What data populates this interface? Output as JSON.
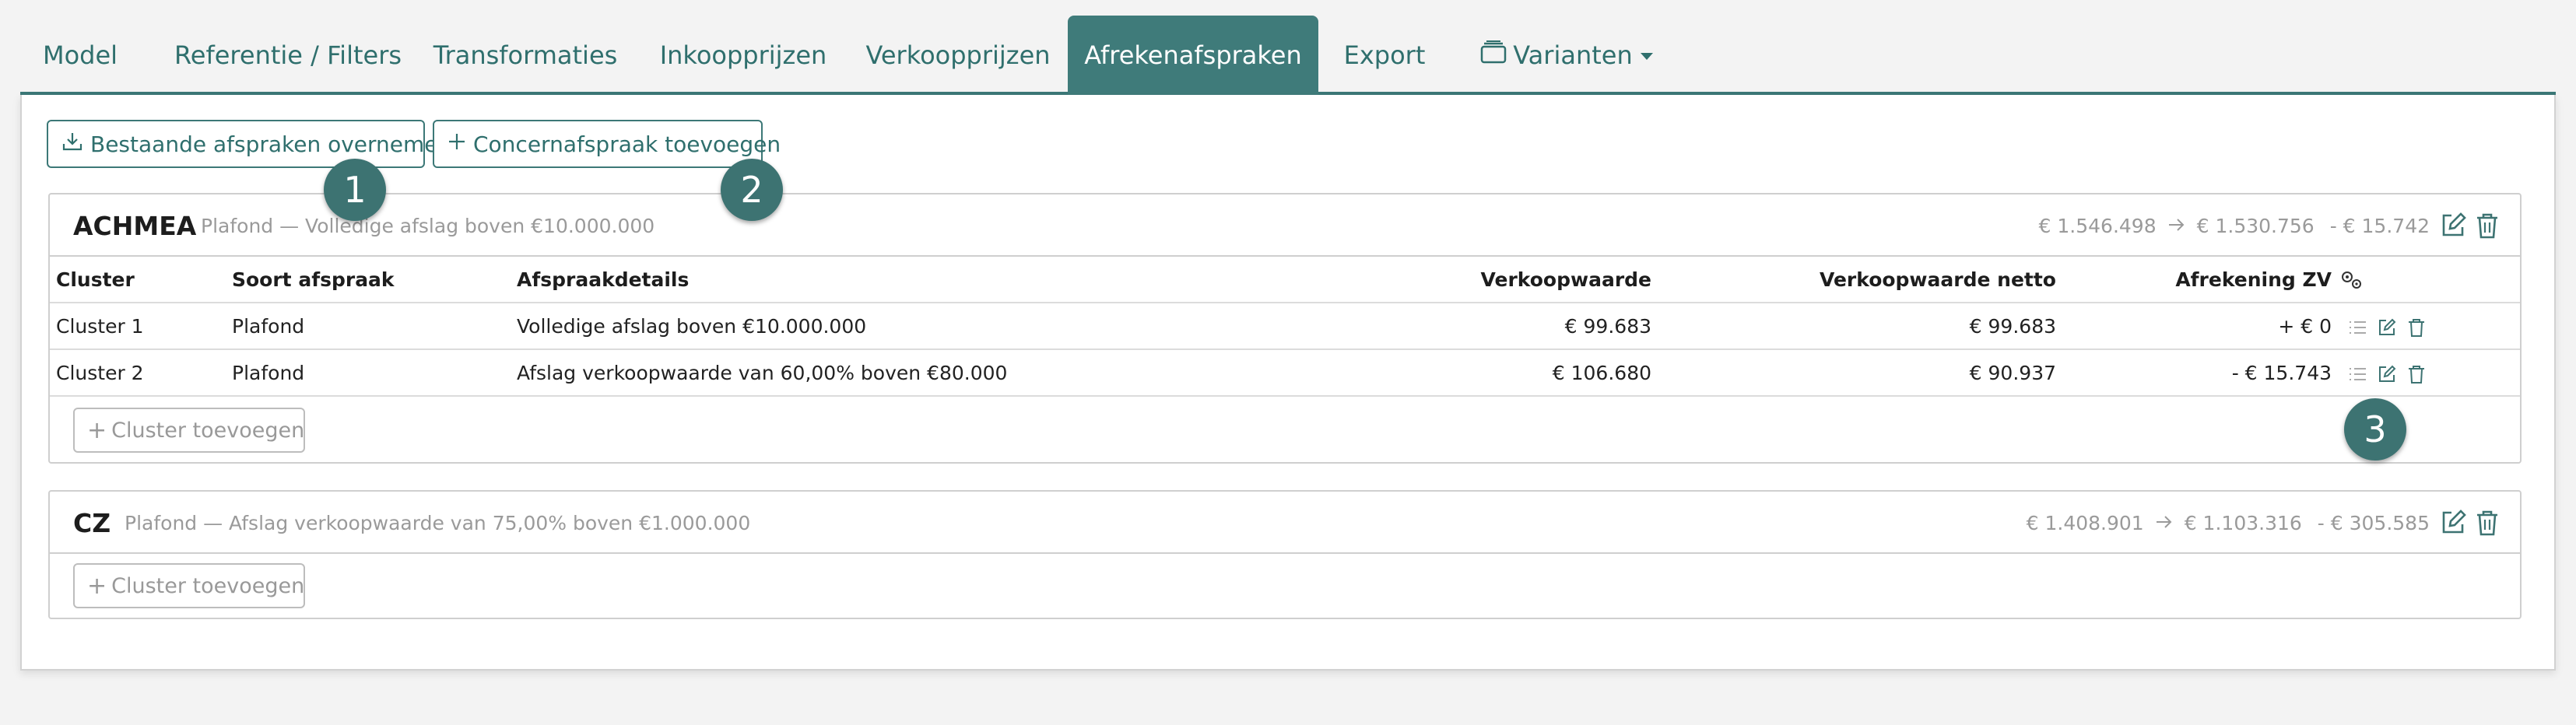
{
  "tabs": [
    {
      "label": "Model"
    },
    {
      "label": "Referentie / Filters"
    },
    {
      "label": "Transformaties"
    },
    {
      "label": "Inkoopprijzen"
    },
    {
      "label": "Verkoopprijzen"
    },
    {
      "label": "Afrekenafspraken",
      "active": true
    },
    {
      "label": "Export"
    },
    {
      "label": "Varianten",
      "dropdown": true,
      "icon": "stack-icon"
    }
  ],
  "toolbar": {
    "import_label": "Bestaande afspraken overnemen",
    "add_label": "Concernafspraak toevoegen"
  },
  "table_headers": {
    "cluster": "Cluster",
    "soort": "Soort afspraak",
    "details": "Afspraakdetails",
    "verkoopwaarde": "Verkoopwaarde",
    "netto": "Verkoopwaarde netto",
    "afrekening": "Afrekening ZV"
  },
  "cards": [
    {
      "title": "ACHMEA",
      "subtitle": "Plafond — Volledige afslag boven €10.000.000",
      "from": "€ 1.546.498",
      "to": "€ 1.530.756",
      "diff": "- € 15.742",
      "rows": [
        {
          "cluster": "Cluster 1",
          "soort": "Plafond",
          "details": "Volledige afslag boven €10.000.000",
          "verkoopwaarde": "€ 99.683",
          "netto": "€ 99.683",
          "afrekening": "+ € 0"
        },
        {
          "cluster": "Cluster 2",
          "soort": "Plafond",
          "details": "Afslag verkoopwaarde van 60,00% boven €80.000",
          "verkoopwaarde": "€ 106.680",
          "netto": "€ 90.937",
          "afrekening": "- € 15.743"
        }
      ],
      "add_cluster_label": "Cluster toevoegen"
    },
    {
      "title": "CZ",
      "subtitle": "Plafond — Afslag verkoopwaarde van 75,00% boven €1.000.000",
      "from": "€ 1.408.901",
      "to": "€ 1.103.316",
      "diff": "- € 305.585",
      "add_cluster_label": "Cluster toevoegen"
    }
  ],
  "markers": [
    "1",
    "2",
    "3"
  ],
  "colors": {
    "accent": "#3f7b7a",
    "marker": "#3d7372",
    "muted": "#9a9a9a"
  }
}
